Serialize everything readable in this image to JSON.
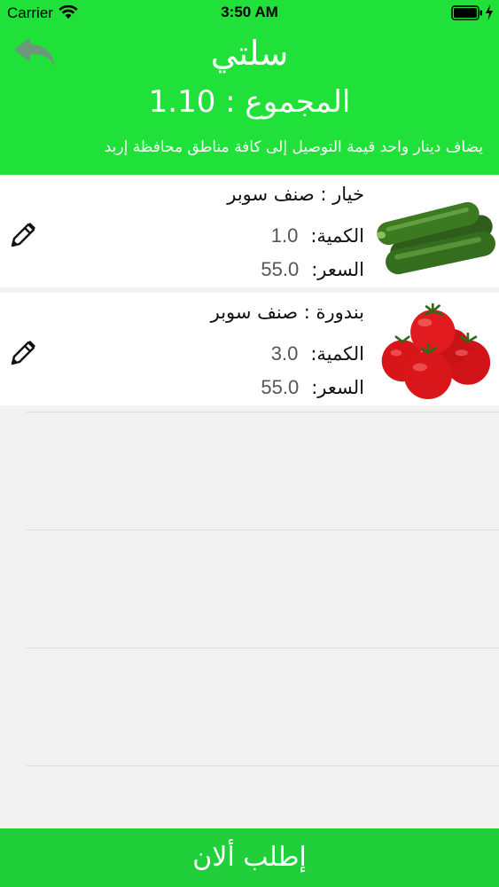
{
  "status_bar": {
    "carrier": "Carrier",
    "time": "3:50 AM"
  },
  "header": {
    "title": "سلتي",
    "total": "المجموع : 1.10",
    "note": "يضاف دينار واحد قيمة التوصيل إلى كافة مناطق محافظة إربد"
  },
  "items": [
    {
      "name": "خيار  : صنف سوبر",
      "qty_label": "الكمية:",
      "qty": "1.0",
      "price_label": "السعر:",
      "price": "55.0",
      "image": "cucumber-image"
    },
    {
      "name": "بندورة : صنف سوبر",
      "qty_label": "الكمية:",
      "qty": "3.0",
      "price_label": "السعر:",
      "price": "55.0",
      "image": "tomato-image"
    }
  ],
  "footer": {
    "order_label": "إطلب ألان"
  },
  "colors": {
    "header_green": "#20e13a",
    "button_green": "#20cf3a"
  }
}
